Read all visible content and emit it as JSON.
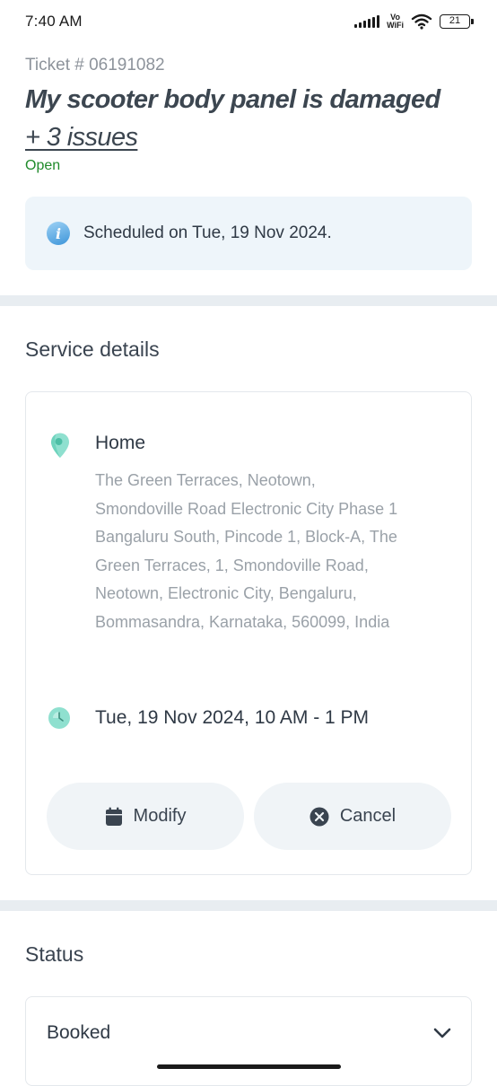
{
  "status_bar": {
    "time": "7:40 AM",
    "network_label_top": "Vo",
    "network_label_bottom": "WiFi",
    "battery_level": "21"
  },
  "ticket": {
    "number": "Ticket # 06191082",
    "title": "My scooter body panel is damaged",
    "more_issues": "+ 3 issues",
    "status": "Open",
    "status_color": "#1f8a2a"
  },
  "schedule_notice": {
    "icon": "info-icon",
    "text": "Scheduled on Tue, 19 Nov 2024."
  },
  "service_details": {
    "heading": "Service details",
    "location_icon": "map-pin-icon",
    "location_name": "Home",
    "address": "The Green Terraces, Neotown, Smondoville Road Electronic City Phase 1 Bangaluru South, Pincode 1, Block-A, The Green Terraces, 1, Smondoville Road, Neotown, Electronic City, Bengaluru, Bommasandra, Karnataka, 560099, India",
    "time_icon": "clock-icon",
    "slot": "Tue, 19 Nov 2024, 10 AM - 1 PM",
    "modify_label": "Modify",
    "cancel_label": "Cancel"
  },
  "status_section": {
    "heading": "Status",
    "current": "Booked",
    "expand_icon": "chevron-down-icon"
  },
  "colors": {
    "accent_teal": "#5fc9b3",
    "info_blue": "#3d95d9",
    "open_green": "#1f8a2a"
  }
}
